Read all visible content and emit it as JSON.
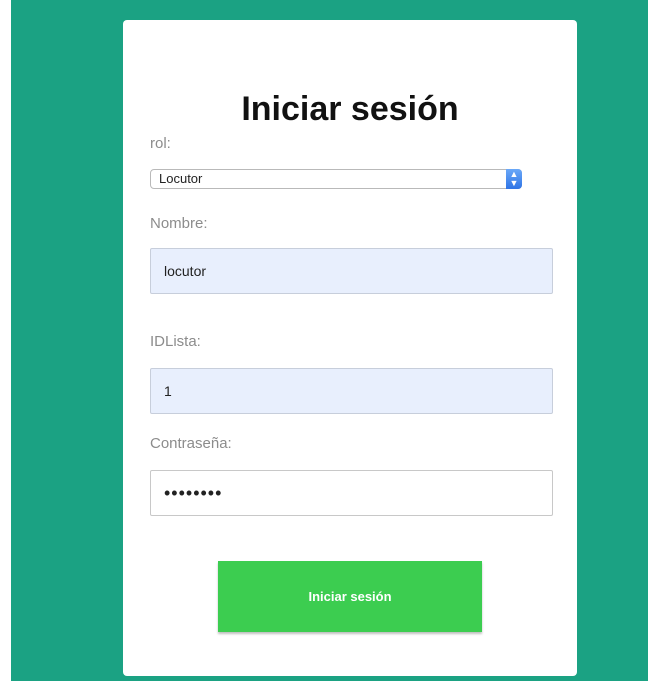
{
  "page": {
    "title": "Iniciar sesión"
  },
  "form": {
    "rol_label": "rol:",
    "rol_value": "Locutor",
    "nombre_label": "Nombre:",
    "nombre_value": "locutor",
    "idlista_label": "IDLista:",
    "idlista_value": "1",
    "password_label": "Contraseña:",
    "password_masked": "••••••••",
    "submit_label": "Iniciar sesión"
  },
  "colors": {
    "background": "#1ba283",
    "button": "#3ccd50",
    "autofill": "#e8effd"
  }
}
